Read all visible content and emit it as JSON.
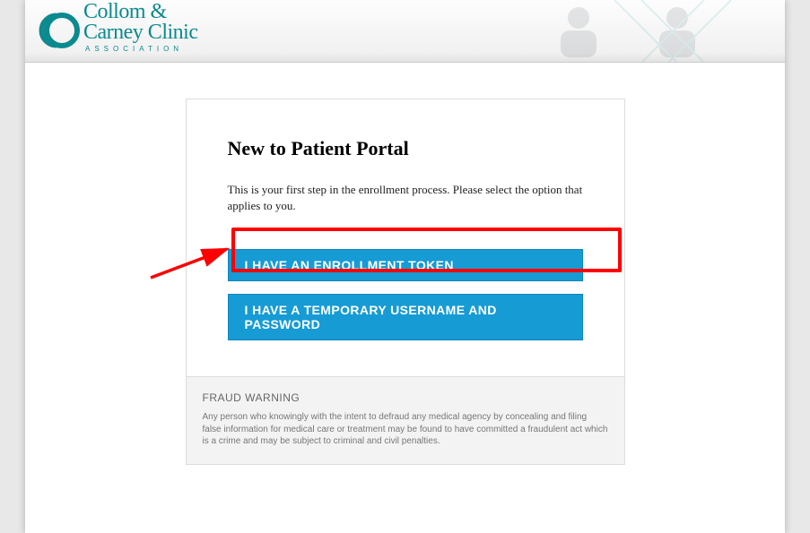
{
  "header": {
    "logo_line1": "Collom &",
    "logo_line2": "Carney Clinic",
    "logo_assoc": "ASSOCIATION"
  },
  "main": {
    "title": "New to Patient Portal",
    "description": "This is your first step in the enrollment process. Please select the option that applies to you.",
    "button_token": "I HAVE AN ENROLLMENT TOKEN",
    "button_temp": "I HAVE A TEMPORARY USERNAME AND PASSWORD"
  },
  "fraud": {
    "title": "FRAUD WARNING",
    "text": "Any person who knowingly with the intent to defraud any medical agency by concealing and filing false information for medical care or treatment may be found to have committed a fraudulent act which is a crime and may be subject to criminal and civil penalties."
  }
}
